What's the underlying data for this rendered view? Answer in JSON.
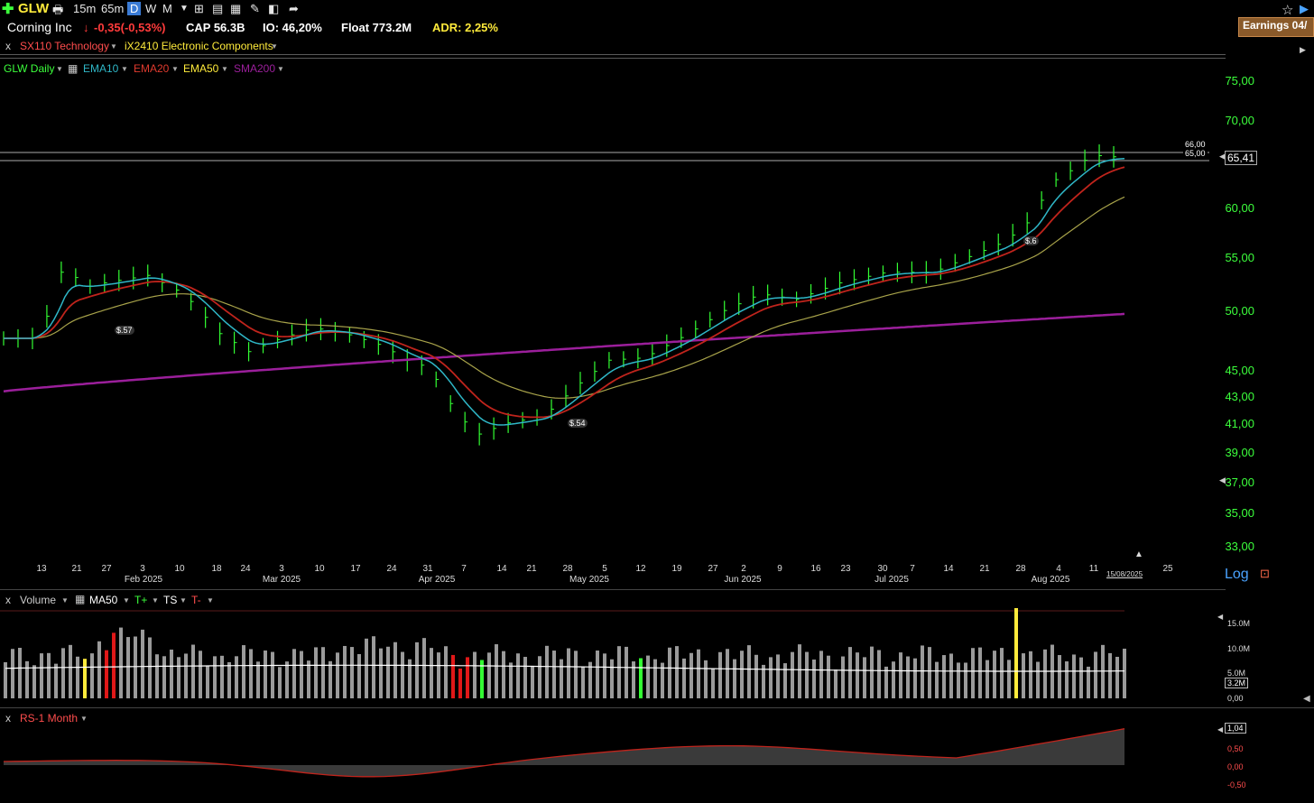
{
  "toolbar": {
    "symbol": "GLW",
    "timeframes": [
      "15m",
      "65m",
      "D",
      "W",
      "M"
    ],
    "active_timeframe": "D"
  },
  "info": {
    "company": "Corning Inc",
    "change": "-0,35(-0,53%)",
    "cap": "CAP 56.3B",
    "io": "IO: 46,20%",
    "float": "Float 773.2M",
    "adr": "ADR: 2,25%",
    "earnings": "Earnings 04/"
  },
  "groups": {
    "close": "x",
    "sector": "SX110 Technology",
    "industry": "iX2410 Electronic Components"
  },
  "legend": {
    "series": "GLW Daily",
    "ema10": "EMA10",
    "ema20": "EMA20",
    "ema50": "EMA50",
    "sma200": "SMA200"
  },
  "colors": {
    "up_bar": "#33ff33",
    "ema10": "#2fb7c7",
    "ema20": "#c0241c",
    "ema50": "#a8a34a",
    "sma200": "#9b1f9b",
    "axis_text": "#3cff3c"
  },
  "price_axis": {
    "scale": "log",
    "ticks": [
      "75,00",
      "70,00",
      "60,00",
      "55,00",
      "50,00",
      "45,00",
      "43,00",
      "41,00",
      "39,00",
      "37,00",
      "35,00",
      "33,00"
    ],
    "current_price": "65,41",
    "levels": [
      "66,00",
      "65,00"
    ],
    "scale_label": "Log"
  },
  "x_axis": {
    "days": [
      "13",
      "21",
      "27",
      "3",
      "10",
      "18",
      "24",
      "3",
      "10",
      "17",
      "24",
      "31",
      "7",
      "14",
      "21",
      "28",
      "5",
      "12",
      "19",
      "27",
      "2",
      "9",
      "16",
      "23",
      "30",
      "7",
      "14",
      "21",
      "28",
      "4",
      "11",
      "25"
    ],
    "months": [
      "Feb 2025",
      "Mar 2025",
      "Apr 2025",
      "May 2025",
      "Jun 2025",
      "Jul 2025",
      "Aug 2025"
    ],
    "last_date": "15/08/2025"
  },
  "dividends": [
    "$.57",
    "$.54",
    "$.6"
  ],
  "volume_panel": {
    "close": "x",
    "title": "Volume",
    "ma": "MA50",
    "tplus": "T+",
    "ts": "TS",
    "tminus": "T-",
    "ticks": [
      "15.0M",
      "10.0M",
      "5.0M",
      "0,00"
    ],
    "current": "3.2M"
  },
  "rs_panel": {
    "close": "x",
    "title": "RS-1 Month",
    "current": "1,04",
    "ticks": [
      "0,50",
      "0,00",
      "-0,50"
    ]
  }
}
